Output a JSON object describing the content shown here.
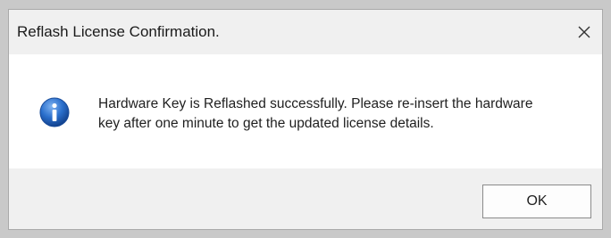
{
  "window": {
    "title": "Reflash License Confirmation.",
    "close_icon": "close-icon"
  },
  "message": {
    "icon": "info-icon",
    "line1": "Hardware Key is Reflashed successfully. Please re-insert the hardware",
    "line2": "key after one minute to get the updated license details."
  },
  "buttons": {
    "ok_label": "OK"
  },
  "colors": {
    "titlebar_bg": "#f0f0f0",
    "content_bg": "#ffffff",
    "footer_bg": "#f0f0f0",
    "info_icon_blue": "#1f5fb4"
  }
}
